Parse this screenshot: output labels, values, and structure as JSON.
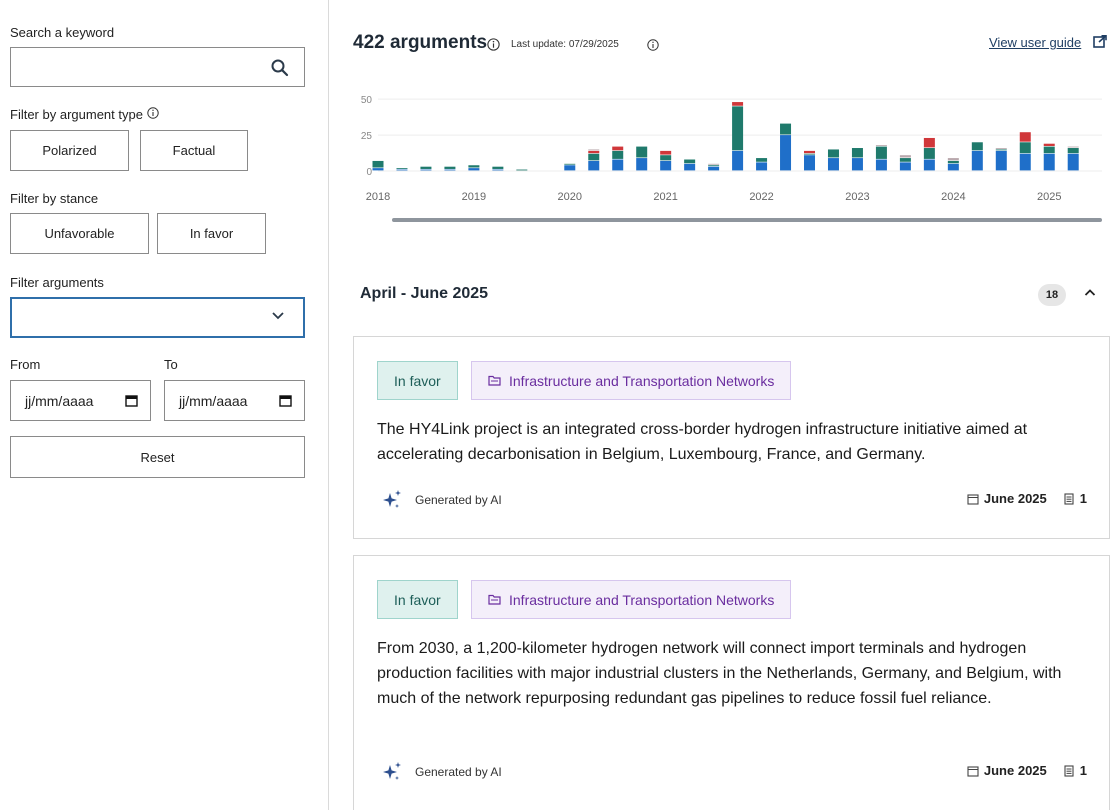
{
  "sidebar": {
    "search_label": "Search a keyword",
    "search_value": "",
    "type_label": "Filter by argument type",
    "type_buttons": [
      "Polarized",
      "Factual"
    ],
    "stance_label": "Filter by stance",
    "stance_buttons": [
      "Unfavorable",
      "In favor"
    ],
    "args_label": "Filter arguments",
    "args_value": "",
    "from_label": "From",
    "to_label": "To",
    "from_placeholder": "jj/mm/aaaa",
    "to_placeholder": "jj/mm/aaaa",
    "reset_label": "Reset"
  },
  "header": {
    "count": "422 arguments",
    "last_update": "Last update: 07/29/2025",
    "guide_link": "View user guide"
  },
  "chart_data": {
    "type": "bar",
    "stacked": true,
    "y_ticks": [
      "50",
      "25",
      "0"
    ],
    "ylim": [
      0,
      55
    ],
    "xlim": [
      2018,
      2025.3
    ],
    "x_ticks": [
      "2018",
      "2019",
      "2020",
      "2021",
      "2022",
      "2023",
      "2024",
      "2025"
    ],
    "colors": {
      "blue": "#1f6fc9",
      "green": "#1f7a6c",
      "red": "#d0373a",
      "grey": "#b9a8ad"
    },
    "x": [
      2018.0,
      2018.25,
      2018.5,
      2018.75,
      2019.0,
      2019.25,
      2019.5,
      2019.75,
      2020.0,
      2020.25,
      2020.5,
      2020.75,
      2021.0,
      2021.25,
      2021.5,
      2021.75,
      2022.0,
      2022.25,
      2022.5,
      2022.75,
      2023.0,
      2023.25,
      2023.5,
      2023.75,
      2024.0,
      2024.25,
      2024.5,
      2024.75,
      2025.0,
      2025.25
    ],
    "series": [
      {
        "color": "blue",
        "values": [
          2,
          1,
          1,
          1,
          2,
          1,
          0,
          0,
          4,
          7,
          8,
          9,
          7,
          5,
          3,
          14,
          6,
          25,
          11,
          9,
          9,
          8,
          6,
          8,
          5,
          14,
          14,
          12,
          12,
          12
        ]
      },
      {
        "color": "green",
        "values": [
          5,
          1,
          2,
          2,
          2,
          2,
          1,
          0,
          1,
          5,
          6,
          8,
          4,
          3,
          1,
          31,
          3,
          8,
          1,
          6,
          7,
          9,
          3,
          8,
          2,
          6,
          1,
          8,
          5,
          4
        ]
      },
      {
        "color": "red",
        "values": [
          0,
          0,
          0,
          0,
          0,
          0,
          0,
          0,
          0,
          2,
          3,
          0,
          3,
          0,
          0,
          3,
          0,
          0,
          2,
          0,
          0,
          0,
          0,
          7,
          0,
          0,
          0,
          7,
          2,
          0
        ]
      },
      {
        "color": "grey",
        "values": [
          0,
          0,
          0,
          0,
          0,
          0,
          0,
          0,
          0,
          1,
          0,
          0,
          0,
          0,
          1,
          0,
          0,
          0,
          0,
          0,
          0,
          1,
          2,
          0,
          2,
          0,
          1,
          0,
          0,
          1
        ]
      }
    ]
  },
  "period": {
    "title": "April - June 2025",
    "count": "18"
  },
  "cards": [
    {
      "stance": "In favor",
      "category": "Infrastructure and Transportation Networks",
      "text": "The HY4Link project is an integrated cross-border hydrogen infrastructure initiative aimed at accelerating decarbonisation in Belgium, Luxembourg, France, and Germany.",
      "ai_label": "Generated by AI",
      "date": "June 2025",
      "sources": "1"
    },
    {
      "stance": "In favor",
      "category": "Infrastructure and Transportation Networks",
      "text": "From 2030, a 1,200-kilometer hydrogen network will connect import terminals and hydrogen production facilities with major industrial clusters in the Netherlands, Germany, and Belgium, with much of the network repurposing redundant gas pipelines to reduce fossil fuel reliance.",
      "ai_label": "Generated by AI",
      "date": "June 2025",
      "sources": "1"
    }
  ]
}
